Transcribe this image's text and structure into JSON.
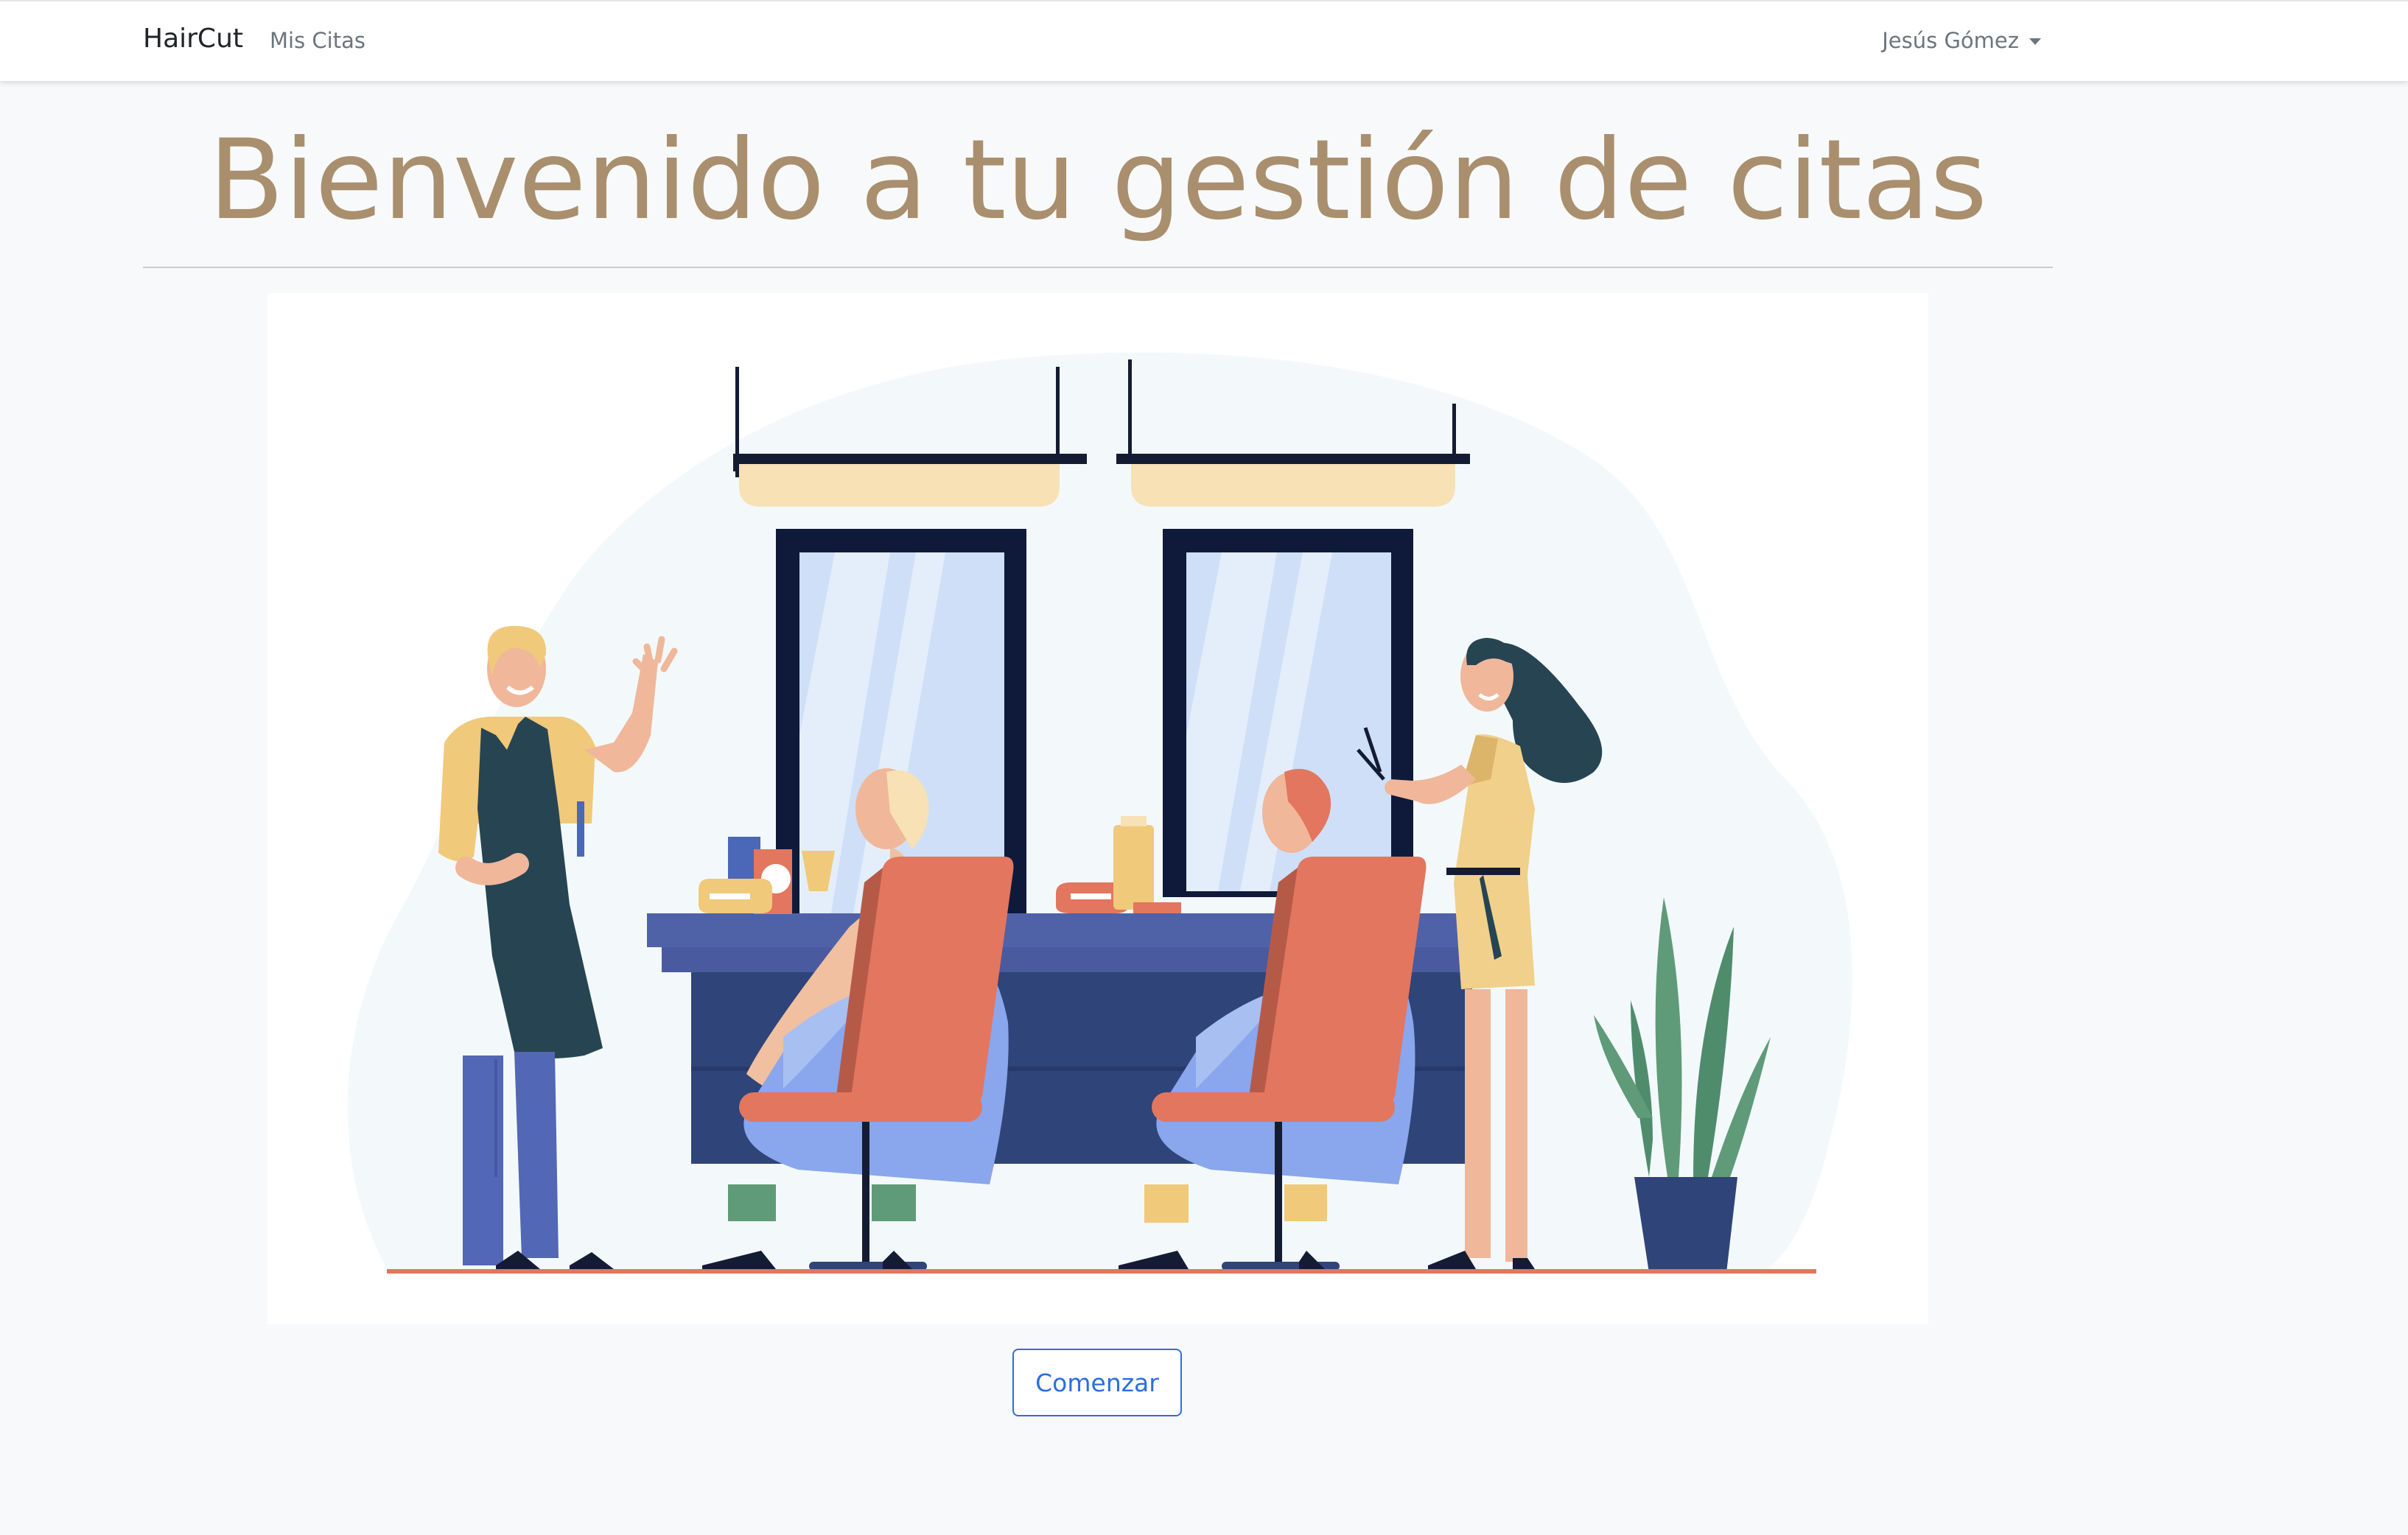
{
  "navbar": {
    "brand": "HairCut",
    "links": [
      "Mis Citas"
    ],
    "user_name": "Jesús Gómez"
  },
  "main": {
    "title": "Bienvenido a tu gestión de citas",
    "start_button": "Comenzar"
  },
  "colors": {
    "title": "#a98f6e",
    "primary": "#2b6fde",
    "background": "#f8f9fa",
    "navbar": "#ffffff"
  },
  "icons": {
    "user_menu": "caret-down-icon"
  }
}
